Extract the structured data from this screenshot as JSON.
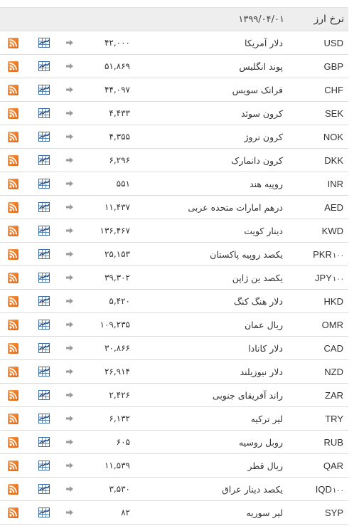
{
  "header": {
    "title": "نرخ ارز",
    "date": "۱۳۹۹/۰۴/۰۱"
  },
  "icons": {
    "rss": "rss-feed-icon",
    "chart": "line-chart-icon",
    "arrow": "arrow-right-icon"
  },
  "colors": {
    "header_bg": "#eeeeee",
    "rss_orange": "#ee7a22",
    "chart_blue": "#3a6ea5",
    "arrow_gray": "#9a9a9a",
    "row_border": "#dddddd"
  },
  "rates": [
    {
      "code": "USD",
      "unit": "",
      "name": "دلار آمریکا",
      "value": "۴۲,۰۰۰"
    },
    {
      "code": "GBP",
      "unit": "",
      "name": "پوند انگلیس",
      "value": "۵۱,۸۶۹"
    },
    {
      "code": "CHF",
      "unit": "",
      "name": "فرانک سویس",
      "value": "۴۴,۰۹۷"
    },
    {
      "code": "SEK",
      "unit": "",
      "name": "کرون سوئد",
      "value": "۴,۴۳۳"
    },
    {
      "code": "NOK",
      "unit": "",
      "name": "کرون نروژ",
      "value": "۴,۳۵۵"
    },
    {
      "code": "DKK",
      "unit": "",
      "name": "کرون دانمارک",
      "value": "۶,۲۹۶"
    },
    {
      "code": "INR",
      "unit": "",
      "name": "روپیه هند",
      "value": "۵۵۱"
    },
    {
      "code": "AED",
      "unit": "",
      "name": "درهم امارات متحده عربی",
      "value": "۱۱,۴۳۷"
    },
    {
      "code": "KWD",
      "unit": "",
      "name": "دینار کویت",
      "value": "۱۳۶,۴۶۷"
    },
    {
      "code": "PKR",
      "unit": "۱۰۰",
      "name": "یکصد روپیه پاکستان",
      "value": "۲۵,۱۵۳"
    },
    {
      "code": "JPY",
      "unit": "۱۰۰",
      "name": "یکصد ین ژاپن",
      "value": "۳۹,۳۰۲"
    },
    {
      "code": "HKD",
      "unit": "",
      "name": "دلار هنگ کنگ",
      "value": "۵,۴۲۰"
    },
    {
      "code": "OMR",
      "unit": "",
      "name": "ریال عمان",
      "value": "۱۰۹,۲۳۵"
    },
    {
      "code": "CAD",
      "unit": "",
      "name": "دلار کانادا",
      "value": "۳۰,۸۶۶"
    },
    {
      "code": "NZD",
      "unit": "",
      "name": "دلار نیوزیلند",
      "value": "۲۶,۹۱۴"
    },
    {
      "code": "ZAR",
      "unit": "",
      "name": "راند آفریقای جنوبی",
      "value": "۲,۴۲۶"
    },
    {
      "code": "TRY",
      "unit": "",
      "name": "لیر ترکیه",
      "value": "۶,۱۳۲"
    },
    {
      "code": "RUB",
      "unit": "",
      "name": "روبل روسیه",
      "value": "۶۰۵"
    },
    {
      "code": "QAR",
      "unit": "",
      "name": "ریال قطر",
      "value": "۱۱,۵۳۹"
    },
    {
      "code": "IQD",
      "unit": "۱۰۰",
      "name": "یکصد دینار عراق",
      "value": "۳,۵۳۰"
    },
    {
      "code": "SYP",
      "unit": "",
      "name": "لیر سوریه",
      "value": "۸۲"
    }
  ]
}
